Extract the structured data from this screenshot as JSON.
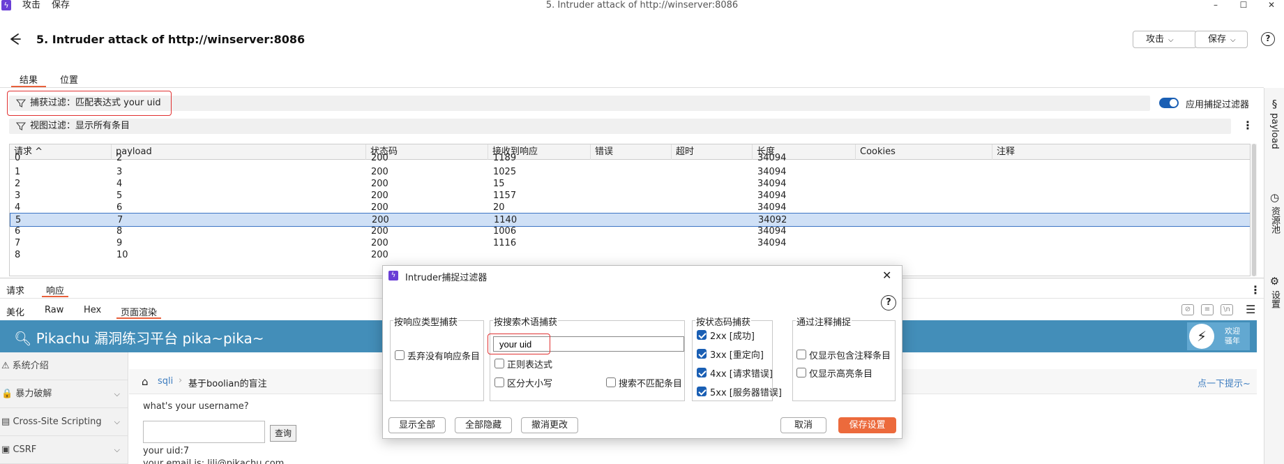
{
  "menu": {
    "attack": "攻击",
    "save": "保存"
  },
  "window_title": "5. Intruder attack of http://winserver:8086",
  "window_controls": {
    "minimize": "–",
    "maximize": "☐",
    "close": "✕"
  },
  "header": {
    "title": "5. Intruder attack of http://winserver:8086",
    "attack_button": "攻击",
    "save_button": "保存",
    "help": "?"
  },
  "tabs": [
    {
      "label": "结果"
    },
    {
      "label": "位置"
    }
  ],
  "filters": {
    "capture": "捕获过滤：匹配表达式 your uid",
    "view": "视图过滤：显示所有条目",
    "apply_toggle_label": "应用捕捉过滤器"
  },
  "side_panel": [
    {
      "icon": "§",
      "label": "payload"
    },
    {
      "icon": "◷",
      "label": "资源池"
    },
    {
      "icon": "⚙",
      "label": "设置"
    }
  ],
  "table": {
    "headers": [
      "请求 ^",
      "payload",
      "状态码",
      "接收到响应",
      "错误",
      "超时",
      "长度",
      "Cookies",
      "注释"
    ],
    "partial_row": [
      "0",
      "2",
      "200",
      "1189",
      "",
      "",
      "34094",
      "",
      ""
    ],
    "rows": [
      [
        "1",
        "3",
        "200",
        "1025",
        "",
        "",
        "34094",
        "",
        ""
      ],
      [
        "2",
        "4",
        "200",
        "15",
        "",
        "",
        "34094",
        "",
        ""
      ],
      [
        "3",
        "5",
        "200",
        "1157",
        "",
        "",
        "34094",
        "",
        ""
      ],
      [
        "4",
        "6",
        "200",
        "20",
        "",
        "",
        "34094",
        "",
        ""
      ],
      [
        "5",
        "7",
        "200",
        "1140",
        "",
        "",
        "34092",
        "",
        ""
      ],
      [
        "6",
        "8",
        "200",
        "1006",
        "",
        "",
        "34094",
        "",
        ""
      ],
      [
        "7",
        "9",
        "200",
        "1116",
        "",
        "",
        "34094",
        "",
        ""
      ],
      [
        "8",
        "10",
        "200",
        "",
        "",
        "",
        "",
        "",
        ""
      ]
    ]
  },
  "lower_tabs": {
    "request": "请求",
    "response": "响应"
  },
  "view_tabs": [
    {
      "label": "美化"
    },
    {
      "label": "Raw"
    },
    {
      "label": "Hex"
    },
    {
      "label": "页面渲染"
    }
  ],
  "render": {
    "site_title": "Pikachu 漏洞练习平台 pika~pika~",
    "welcome": [
      "欢迎",
      "骚年"
    ],
    "nav": [
      {
        "label": "系统介绍",
        "icon": "⚠"
      },
      {
        "label": "暴力破解",
        "icon": "🔒"
      },
      {
        "label": "Cross-Site Scripting",
        "icon": "▤"
      },
      {
        "label": "CSRF",
        "icon": "▣"
      }
    ],
    "breadcrumb": {
      "section": "sqli",
      "page": "基于boolian的盲注",
      "hint": "点一下提示~"
    },
    "question": "what's your username?",
    "query_button": "查询",
    "uid_line": "your uid:7",
    "email_line": "your email is: lili@pikachu.com"
  },
  "dialog": {
    "title": "Intruder捕捉过滤器",
    "groups": {
      "response_type": {
        "label": "按响应类型捕获",
        "options": [
          {
            "label": "丢弃没有响应条目",
            "checked": false
          }
        ]
      },
      "search_term": {
        "label": "按搜索术语捕获",
        "value": "your uid",
        "options": [
          {
            "label": "正则表达式",
            "checked": false
          },
          {
            "label": "区分大小写",
            "checked": false
          },
          {
            "label": "搜索不匹配条目",
            "checked": false
          }
        ]
      },
      "status_code": {
        "label": "按状态码捕获",
        "options": [
          {
            "label": "2xx  [成功]",
            "checked": true
          },
          {
            "label": "3xx  [重定向]",
            "checked": true
          },
          {
            "label": "4xx  [请求错误]",
            "checked": true
          },
          {
            "label": "5xx  [服务器错误]",
            "checked": true
          }
        ]
      },
      "annotation": {
        "label": "通过注释捕捉",
        "options": [
          {
            "label": "仅显示包含注释条目",
            "checked": false
          },
          {
            "label": "仅显示高亮条目",
            "checked": false
          }
        ]
      }
    },
    "buttons": {
      "show_all": "显示全部",
      "hide_all": "全部隐藏",
      "revert": "撤消更改",
      "cancel": "取消",
      "save": "保存设置"
    }
  },
  "colors": {
    "accent": "#e8603c",
    "toggle_on": "#1a5fb4",
    "pikachu_header": "#438eb9",
    "highlight": "#e03030",
    "selected_row": "#cfe0f6"
  }
}
